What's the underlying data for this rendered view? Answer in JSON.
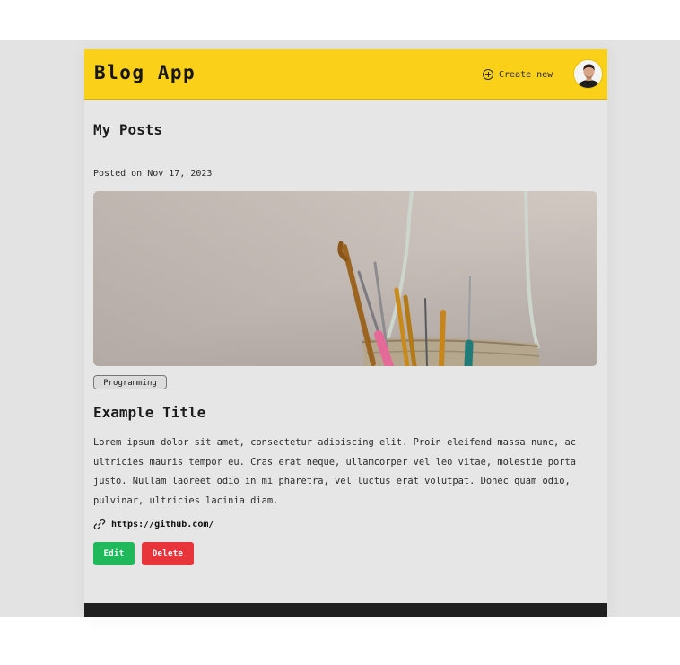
{
  "header": {
    "app_title": "Blog App",
    "create_label": "Create new",
    "create_icon": "plus-circle-icon",
    "avatar_icon": "user-avatar"
  },
  "page": {
    "title": "My Posts"
  },
  "post": {
    "posted_on": "Posted on Nov 17, 2023",
    "image_subject": "crochet hooks in a basket",
    "tag": "Programming",
    "title": "Example Title",
    "body": "Lorem ipsum dolor sit amet, consectetur adipiscing elit. Proin eleifend massa nunc, ac ultricies mauris tempor eu. Cras erat neque, ullamcorper vel leo vitae, molestie porta justo. Nullam laoreet odio in mi pharetra, vel luctus erat volutpat. Donec quam odio, pulvinar, ultricies lacinia diam.",
    "link": "https://github.com/",
    "link_icon": "link-icon",
    "edit_label": "Edit",
    "delete_label": "Delete"
  },
  "colors": {
    "header_bg": "#fbd018",
    "edit_button": "#1fb95b",
    "delete_button": "#e8343b",
    "footer_bg": "#1f1f1f",
    "page_bg": "#e6e6e6"
  }
}
